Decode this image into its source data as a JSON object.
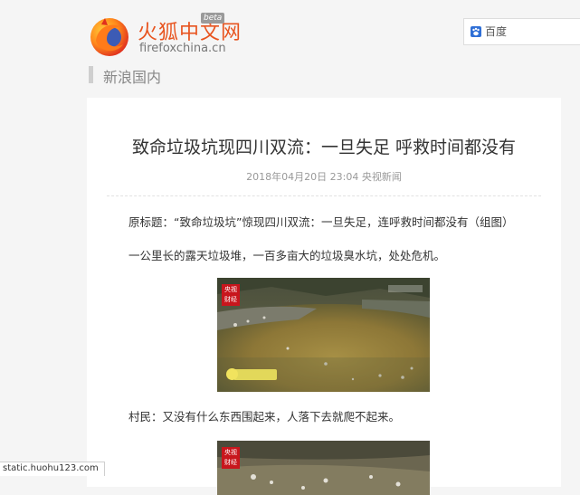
{
  "header": {
    "logo_name": "火狐中文网",
    "logo_badge": "beta",
    "logo_domain": "firefoxchina.cn",
    "search": {
      "placeholder": "百度",
      "icon": "baidu-paw-icon"
    }
  },
  "section": {
    "title": "新浪国内"
  },
  "article": {
    "title": "致命垃圾坑现四川双流：一旦失足 呼救时间都没有",
    "meta": "2018年04月20日 23:04 央视新闻",
    "paragraphs": [
      "原标题：“致命垃圾坑”惊现四川双流：一旦失足，连呼救时间都没有（组图）",
      "一公里长的露天垃圾堆，一百多亩大的垃圾臭水坑，处处危机。",
      "村民：又没有什么东西围起来，人落下去就爬不起来。"
    ],
    "image_badge": "央视\n财经"
  },
  "status_bar": {
    "text": "static.huohu123.com"
  },
  "colors": {
    "brand": "#e8541f",
    "badge_red": "#c8161d",
    "background": "#f5f5f5"
  }
}
